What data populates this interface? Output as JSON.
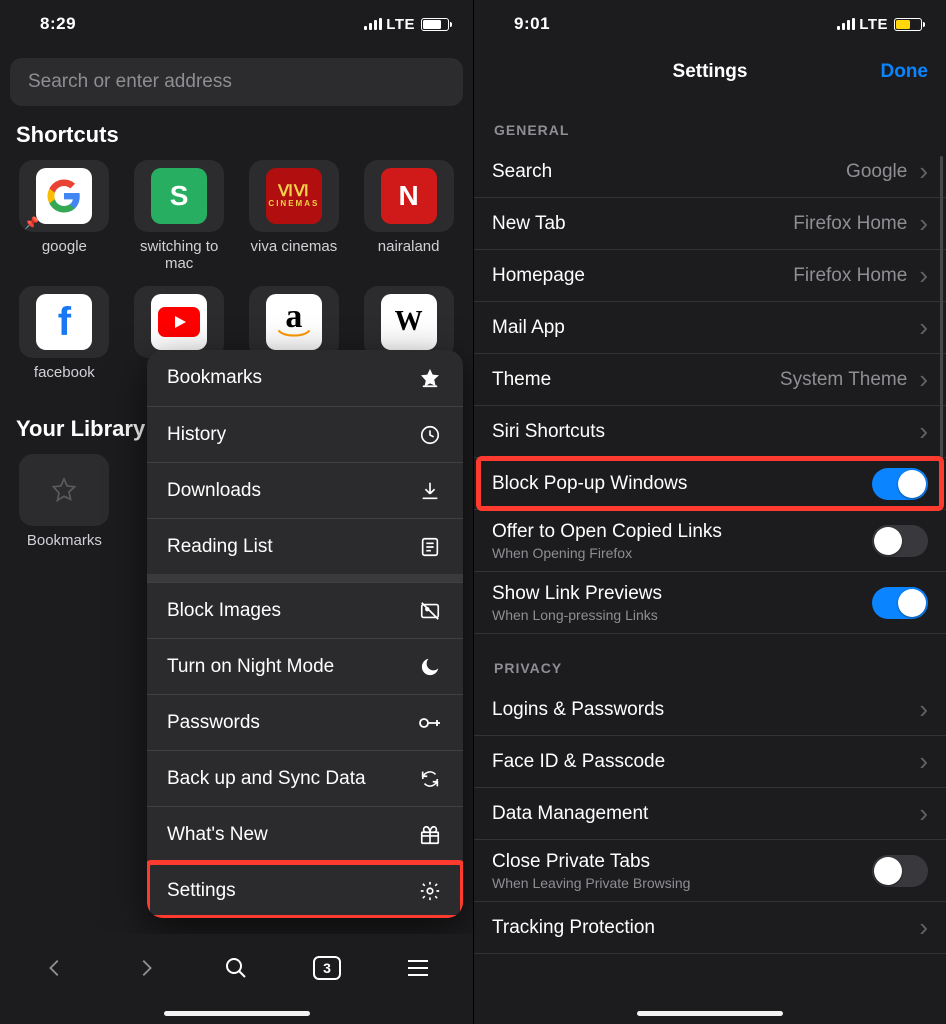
{
  "left": {
    "status": {
      "time": "8:29",
      "network": "LTE"
    },
    "search_placeholder": "Search or enter address",
    "sections": {
      "shortcuts": "Shortcuts",
      "library": "Your Library"
    },
    "shortcuts": [
      {
        "label": "google",
        "icon": "google",
        "pinned": true
      },
      {
        "label": "switching to mac",
        "icon": "s"
      },
      {
        "label": "viva cinemas",
        "icon": "viva"
      },
      {
        "label": "nairaland",
        "icon": "n"
      },
      {
        "label": "facebook",
        "icon": "facebook"
      },
      {
        "label": "",
        "icon": "youtube"
      },
      {
        "label": "",
        "icon": "amazon"
      },
      {
        "label": "",
        "icon": "wikipedia"
      }
    ],
    "library": [
      {
        "label": "Bookmarks"
      }
    ],
    "menu": [
      {
        "label": "Bookmarks",
        "icon": "star"
      },
      {
        "label": "History",
        "icon": "clock"
      },
      {
        "label": "Downloads",
        "icon": "download"
      },
      {
        "label": "Reading List",
        "icon": "reading"
      },
      {
        "divider": true
      },
      {
        "label": "Block Images",
        "icon": "noimage"
      },
      {
        "label": "Turn on Night Mode",
        "icon": "moon"
      },
      {
        "label": "Passwords",
        "icon": "key"
      },
      {
        "label": "Back up and Sync Data",
        "icon": "sync"
      },
      {
        "label": "What's New",
        "icon": "gift"
      },
      {
        "label": "Settings",
        "icon": "gear",
        "highlight": true
      }
    ],
    "toolbar": {
      "tab_count": "3"
    }
  },
  "right": {
    "status": {
      "time": "9:01",
      "network": "LTE"
    },
    "nav": {
      "title": "Settings",
      "done": "Done"
    },
    "sections": [
      {
        "header": "GENERAL",
        "rows": [
          {
            "label": "Search",
            "value": "Google",
            "type": "link"
          },
          {
            "label": "New Tab",
            "value": "Firefox Home",
            "type": "link"
          },
          {
            "label": "Homepage",
            "value": "Firefox Home",
            "type": "link"
          },
          {
            "label": "Mail App",
            "type": "link"
          },
          {
            "label": "Theme",
            "value": "System Theme",
            "type": "link"
          },
          {
            "label": "Siri Shortcuts",
            "type": "link"
          },
          {
            "label": "Block Pop-up Windows",
            "type": "toggle",
            "state": "on",
            "highlight": true
          },
          {
            "label": "Offer to Open Copied Links",
            "sub": "When Opening Firefox",
            "type": "toggle",
            "state": "off"
          },
          {
            "label": "Show Link Previews",
            "sub": "When Long-pressing Links",
            "type": "toggle",
            "state": "on"
          }
        ]
      },
      {
        "header": "PRIVACY",
        "rows": [
          {
            "label": "Logins & Passwords",
            "type": "link"
          },
          {
            "label": "Face ID & Passcode",
            "type": "link"
          },
          {
            "label": "Data Management",
            "type": "link"
          },
          {
            "label": "Close Private Tabs",
            "sub": "When Leaving Private Browsing",
            "type": "toggle",
            "state": "off"
          },
          {
            "label": "Tracking Protection",
            "type": "link"
          }
        ]
      }
    ]
  }
}
